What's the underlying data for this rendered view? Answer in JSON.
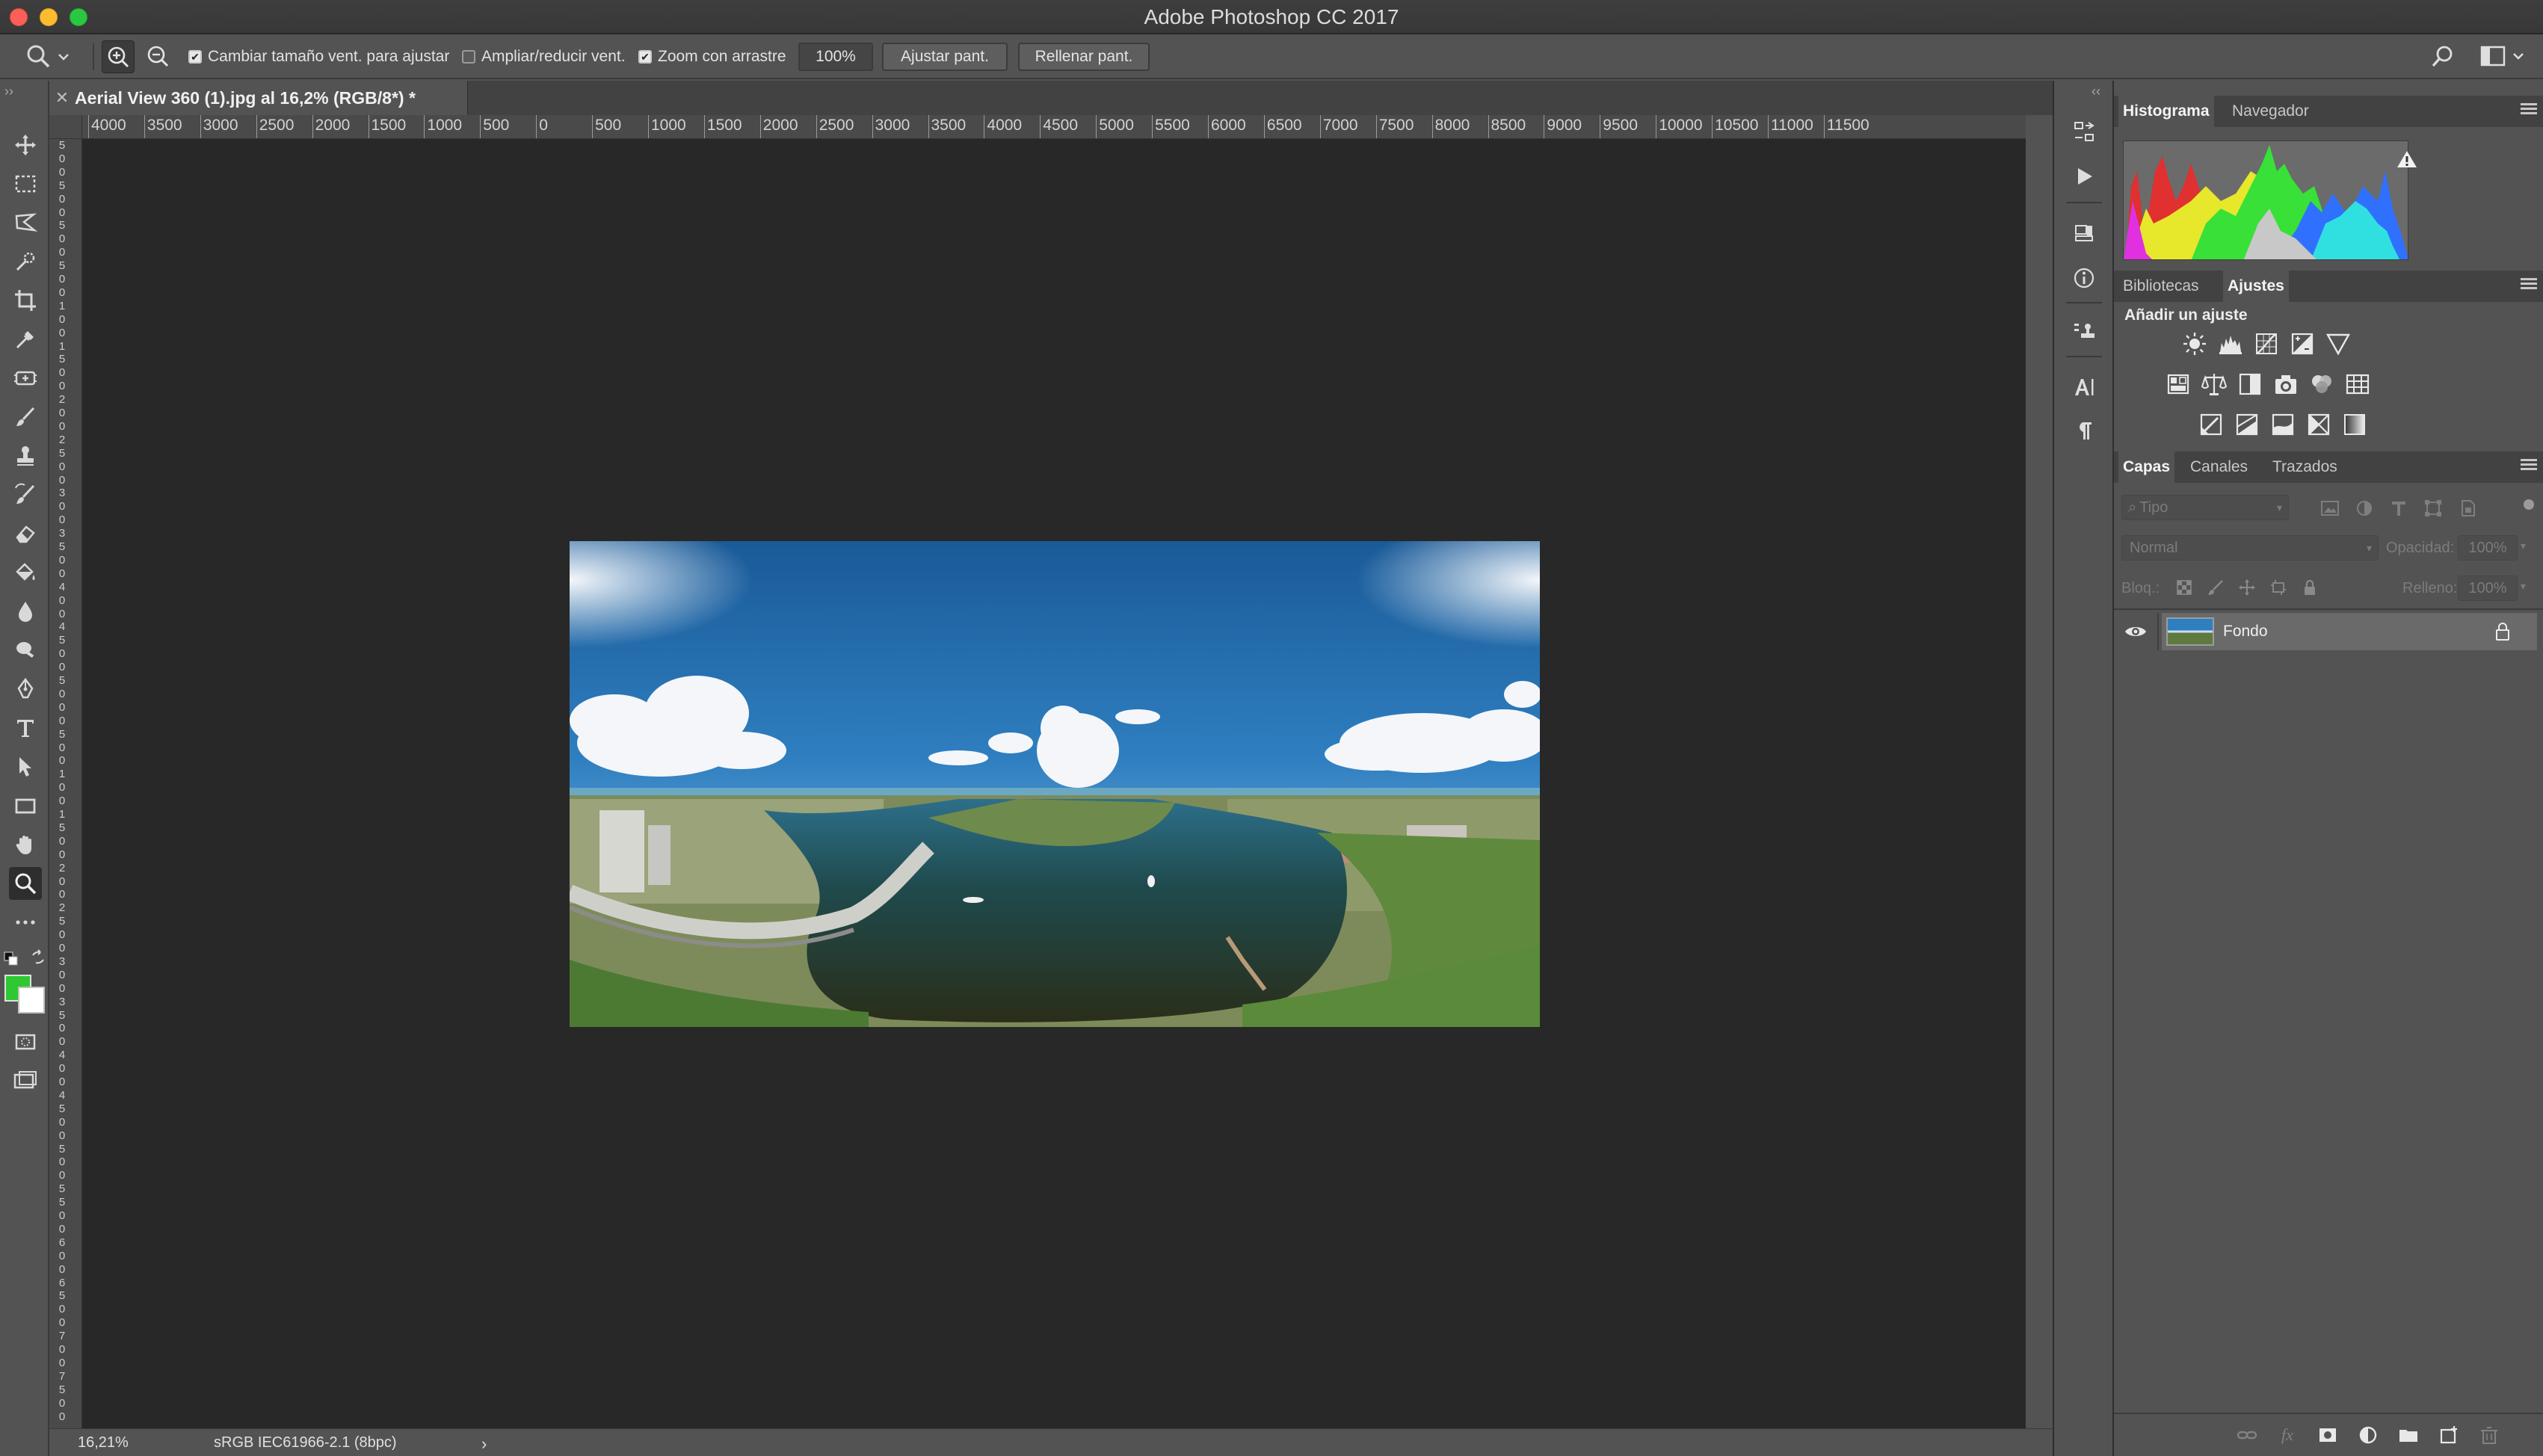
{
  "window": {
    "title": "Adobe Photoshop CC 2017"
  },
  "options_bar": {
    "resize_windows": {
      "label": "Cambiar tamaño vent. para ajustar",
      "checked": true
    },
    "zoom_all": {
      "label": "Ampliar/reducir vent.",
      "checked": false
    },
    "scrubby_zoom": {
      "label": "Zoom con arrastre",
      "checked": true
    },
    "zoom_value": "100%",
    "fit_screen_label": "Ajustar pant.",
    "fill_screen_label": "Rellenar pant."
  },
  "document": {
    "tab_title": "Aerial View 360 (1).jpg al 16,2% (RGB/8*) *",
    "ruler_h_labels": [
      "4000",
      "3500",
      "3000",
      "2500",
      "2000",
      "1500",
      "1000",
      "500",
      "0",
      "500",
      "1000",
      "1500",
      "2000",
      "2500",
      "3000",
      "3500",
      "4000",
      "4500",
      "5000",
      "5500",
      "6000",
      "6500",
      "7000",
      "7500",
      "8000",
      "8500",
      "9000",
      "9500",
      "10000",
      "10500",
      "11000",
      "11500"
    ],
    "ruler_v_labels": [
      "5",
      "0",
      "0",
      "5",
      "0",
      "0",
      "5",
      "0",
      "0",
      "5",
      "0",
      "0",
      "1",
      "0",
      "0",
      "1",
      "5",
      "0",
      "0",
      "2",
      "0",
      "0",
      "2",
      "5",
      "0",
      "0",
      "3",
      "0",
      "0",
      "3",
      "5",
      "0",
      "0",
      "4",
      "0",
      "0",
      "4",
      "5",
      "0",
      "0",
      "5",
      "0",
      "0",
      "0",
      "5",
      "0",
      "0",
      "1",
      "0",
      "0",
      "1",
      "5",
      "0",
      "0",
      "2",
      "0",
      "0",
      "2",
      "5",
      "0",
      "0",
      "3",
      "0",
      "0",
      "3",
      "5",
      "0",
      "0",
      "4",
      "0",
      "0",
      "4",
      "5",
      "0",
      "0",
      "5",
      "0",
      "0",
      "5",
      "5",
      "0",
      "0",
      "6",
      "0",
      "0",
      "6",
      "5",
      "0",
      "0",
      "7",
      "0",
      "0",
      "7",
      "5",
      "0",
      "0"
    ]
  },
  "status_bar": {
    "zoom": "16,21%",
    "profile": "sRGB IEC61966-2.1 (8bpc)"
  },
  "panels": {
    "group1_tabs": [
      "Histograma",
      "Navegador"
    ],
    "group2_tabs": [
      "Bibliotecas",
      "Ajustes"
    ],
    "adjustments_heading": "Añadir un ajuste",
    "group3_tabs": [
      "Capas",
      "Canales",
      "Trazados"
    ],
    "layers": {
      "filter_placeholder": "Tipo",
      "blend_mode": "Normal",
      "opacity_label": "Opacidad:",
      "opacity_value": "100%",
      "lock_label": "Bloq.:",
      "fill_label": "Relleno:",
      "fill_value": "100%",
      "items": [
        {
          "name": "Fondo",
          "visible": true,
          "locked": true
        }
      ]
    }
  },
  "colors": {
    "foreground": "#2ec832",
    "background": "#ffffff",
    "ui_bg": "#535353",
    "canvas_bg": "#282828"
  }
}
